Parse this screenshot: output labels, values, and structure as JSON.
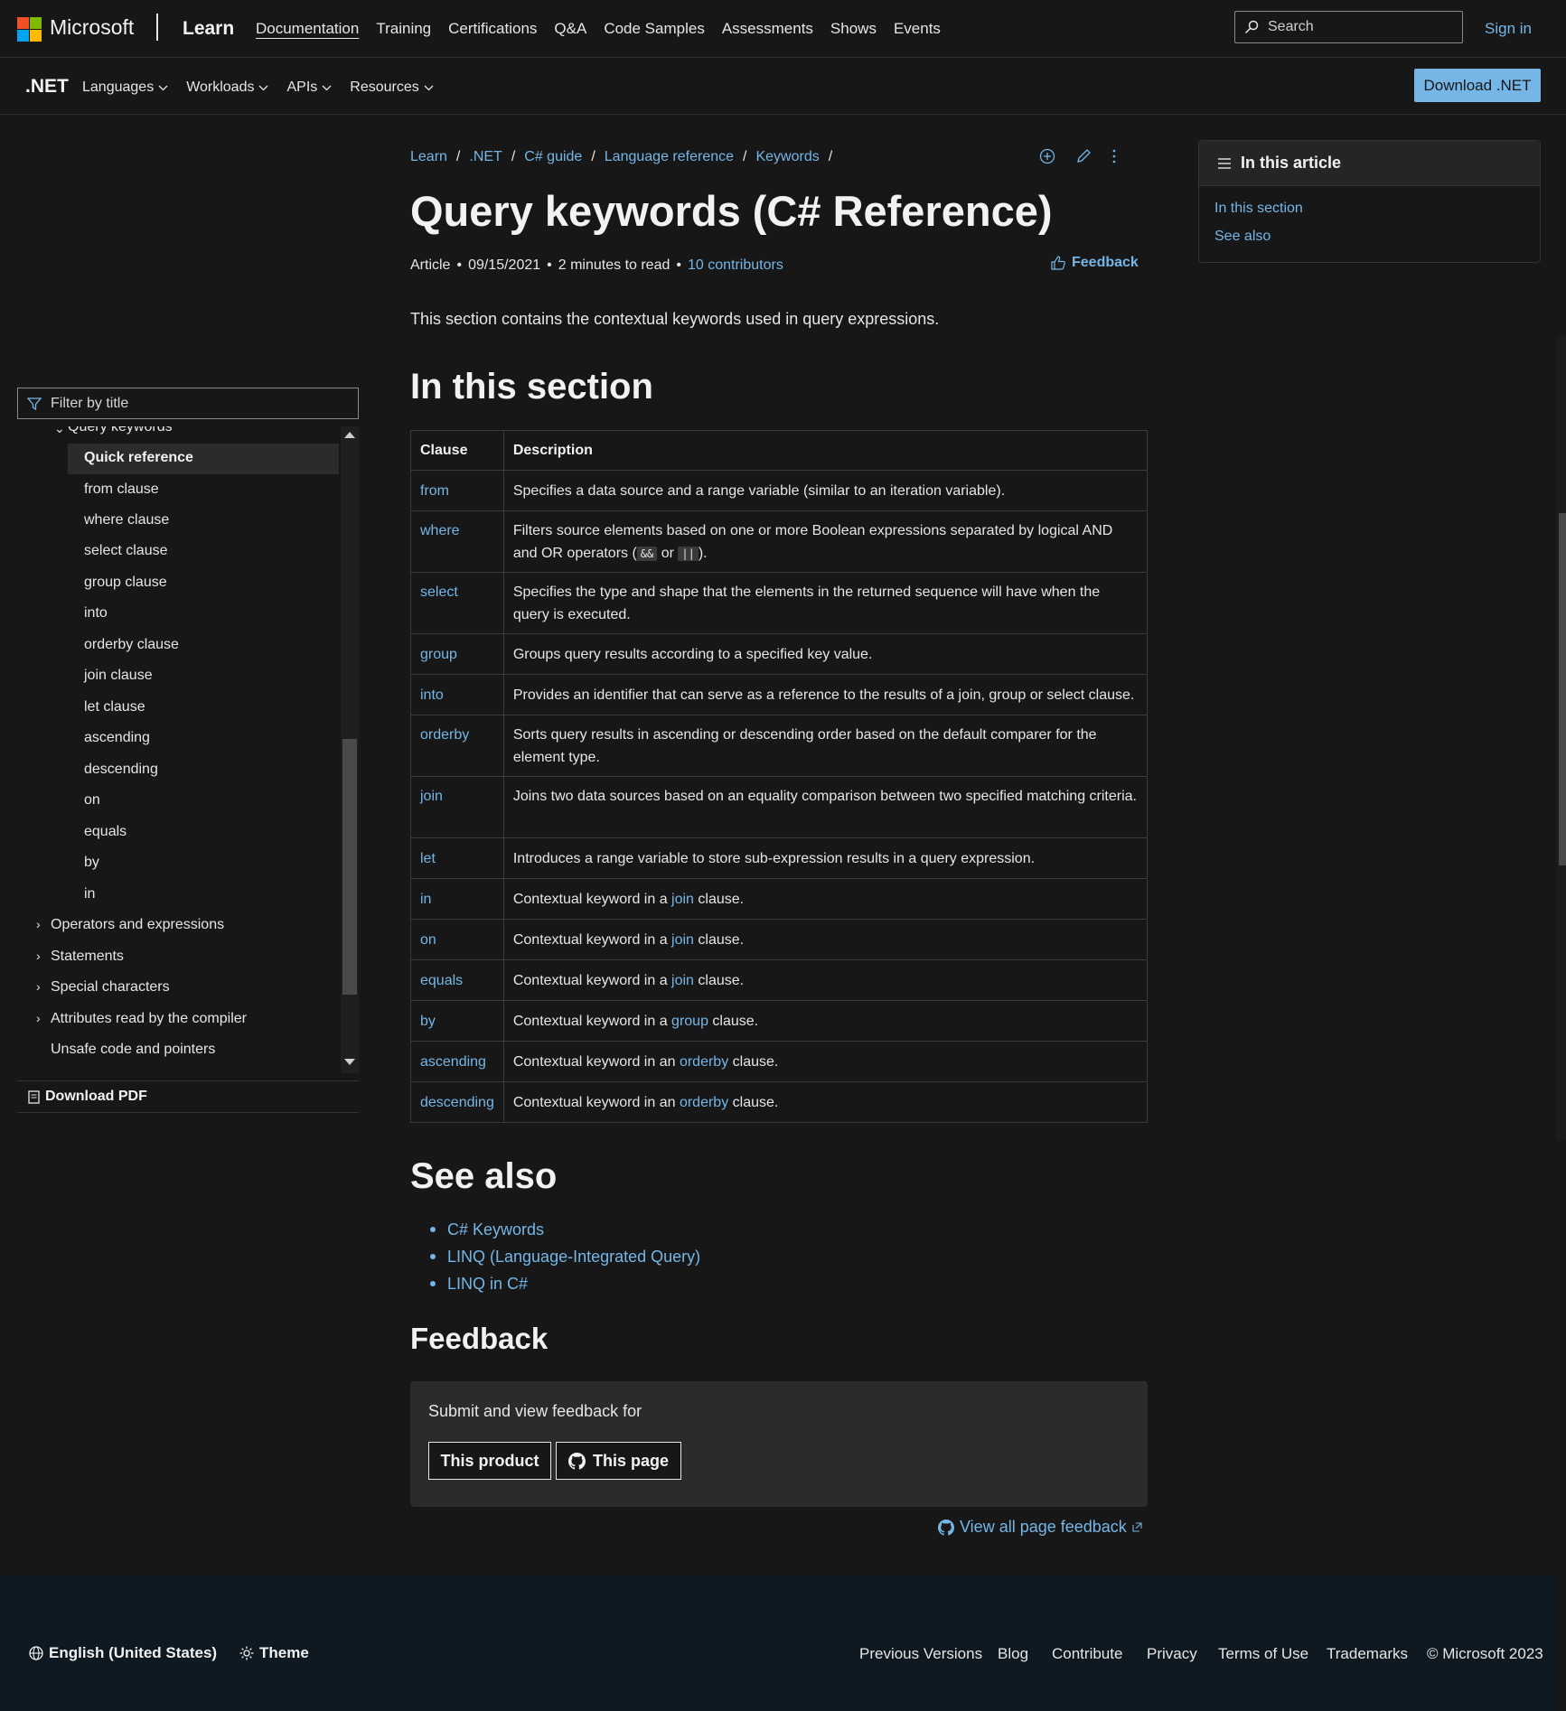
{
  "header": {
    "brand": "Microsoft",
    "site": "Learn",
    "nav": [
      "Documentation",
      "Training",
      "Certifications",
      "Q&A",
      "Code Samples",
      "Assessments",
      "Shows",
      "Events"
    ],
    "active_nav": "Documentation",
    "search_placeholder": "Search",
    "sign_in": "Sign in",
    "logo_colors": [
      "#f25022",
      "#7fba00",
      "#00a4ef",
      "#ffb900"
    ]
  },
  "subnav": {
    "product": ".NET",
    "items": [
      "Languages",
      "Workloads",
      "APIs",
      "Resources"
    ],
    "cta": "Download .NET"
  },
  "sidebar": {
    "filter_placeholder": "Filter by title",
    "parent": "Query keywords",
    "children": [
      "Quick reference",
      "from clause",
      "where clause",
      "select clause",
      "group clause",
      "into",
      "orderby clause",
      "join clause",
      "let clause",
      "ascending",
      "descending",
      "on",
      "equals",
      "by",
      "in"
    ],
    "selected": "Quick reference",
    "siblings": [
      "Operators and expressions",
      "Statements",
      "Special characters",
      "Attributes read by the compiler",
      "Unsafe code and pointers"
    ],
    "download_pdf": "Download PDF"
  },
  "breadcrumb": [
    "Learn",
    ".NET",
    "C# guide",
    "Language reference",
    "Keywords"
  ],
  "article": {
    "title": "Query keywords (C# Reference)",
    "type": "Article",
    "date": "09/15/2021",
    "read_time": "2 minutes to read",
    "contributors": "10 contributors",
    "feedback": "Feedback",
    "intro": "This section contains the contextual keywords used in query expressions.",
    "section_heading": "In this section",
    "table": {
      "headers": [
        "Clause",
        "Description"
      ],
      "rows": [
        {
          "clause": "from",
          "desc": "Specifies a data source and a range variable (similar to an iteration variable)."
        },
        {
          "clause": "where",
          "desc_a": "Filters source elements based on one or more Boolean expressions separated by logical AND and OR operators (",
          "op1": "&&",
          "desc_b": " or ",
          "op2": "||",
          "desc_c": ")."
        },
        {
          "clause": "select",
          "desc": "Specifies the type and shape that the elements in the returned sequence will have when the query is executed."
        },
        {
          "clause": "group",
          "desc": "Groups query results according to a specified key value."
        },
        {
          "clause": "into",
          "desc": "Provides an identifier that can serve as a reference to the results of a join, group or select clause."
        },
        {
          "clause": "orderby",
          "desc": "Sorts query results in ascending or descending order based on the default comparer for the element type."
        },
        {
          "clause": "join",
          "desc": "Joins two data sources based on an equality comparison between two specified matching criteria."
        },
        {
          "clause": "let",
          "desc": "Introduces a range variable to store sub-expression results in a query expression."
        },
        {
          "clause": "in",
          "pre": "Contextual keyword in a ",
          "link": "join",
          "post": " clause."
        },
        {
          "clause": "on",
          "pre": "Contextual keyword in a ",
          "link": "join",
          "post": " clause."
        },
        {
          "clause": "equals",
          "pre": "Contextual keyword in a ",
          "link": "join",
          "post": " clause."
        },
        {
          "clause": "by",
          "pre": "Contextual keyword in a ",
          "link": "group",
          "post": " clause."
        },
        {
          "clause": "ascending",
          "pre": "Contextual keyword in an ",
          "link": "orderby",
          "post": " clause."
        },
        {
          "clause": "descending",
          "pre": "Contextual keyword in an ",
          "link": "orderby",
          "post": " clause."
        }
      ]
    },
    "see_also_heading": "See also",
    "see_also": [
      "C# Keywords",
      "LINQ (Language-Integrated Query)",
      "LINQ in C#"
    ],
    "feedback_heading": "Feedback",
    "feedback_prompt": "Submit and view feedback for",
    "feedback_buttons": [
      "This product",
      "This page"
    ],
    "view_all": "View all page feedback"
  },
  "rail": {
    "heading": "In this article",
    "links": [
      "In this section",
      "See also"
    ]
  },
  "footer": {
    "language": "English (United States)",
    "theme": "Theme",
    "links": [
      "Previous Versions",
      "Blog",
      "Contribute",
      "Privacy",
      "Terms of Use",
      "Trademarks",
      "© Microsoft 2023"
    ]
  },
  "icons": {
    "search": "search-icon",
    "filter": "filter-icon",
    "add": "add-collection-icon",
    "edit": "pencil-icon",
    "more": "more-vertical-icon",
    "feedback": "thumbs-up-icon",
    "list": "list-icon",
    "github": "github-icon",
    "globe": "globe-icon",
    "theme": "sun-icon",
    "pdf": "pdf-icon",
    "external": "external-link-icon"
  }
}
